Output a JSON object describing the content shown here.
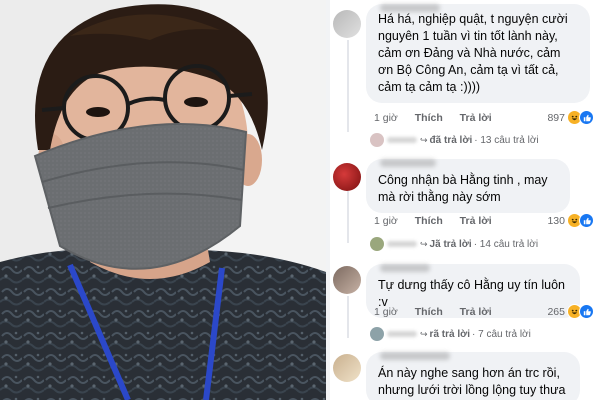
{
  "colors": {
    "bubble": "#f0f2f5",
    "meta": "#65676b",
    "like": "#1877f2",
    "haha": "#f7b125"
  },
  "comments": [
    {
      "text": "Há há, nghiệp quật, t nguyện cười nguyên 1 tuần vì tin tốt lành này, cảm ơn Đảng và Nhà nước, cảm ơn Bộ Công An, cảm tạ vì tất cả, cảm tạ cảm tạ :))))",
      "time": "1 giờ",
      "like": "Thích",
      "reply": "Trả lời",
      "reactions": "897",
      "reply_summary": {
        "replied": "đã trả lời",
        "count": "· 13 câu trả lời"
      }
    },
    {
      "text": "Công nhận bà Hằng tinh , may mà rời thằng này sớm",
      "time": "1 giờ",
      "like": "Thích",
      "reply": "Trả lời",
      "reactions": "130",
      "reply_summary": {
        "replied": "Jã trả lời",
        "count": "· 14 câu trả lời"
      }
    },
    {
      "text": "Tự dưng thấy cô Hằng uy tín luôn :v",
      "time": "1 giờ",
      "like": "Thích",
      "reply": "Trả lời",
      "reactions": "265",
      "reply_summary": {
        "replied": "rã trả lời",
        "count": "· 7 câu trả lời"
      }
    },
    {
      "text": "Án này nghe sang hơn án trc rồi, nhưng lưới trời lồng lộng tuy thưa"
    }
  ]
}
